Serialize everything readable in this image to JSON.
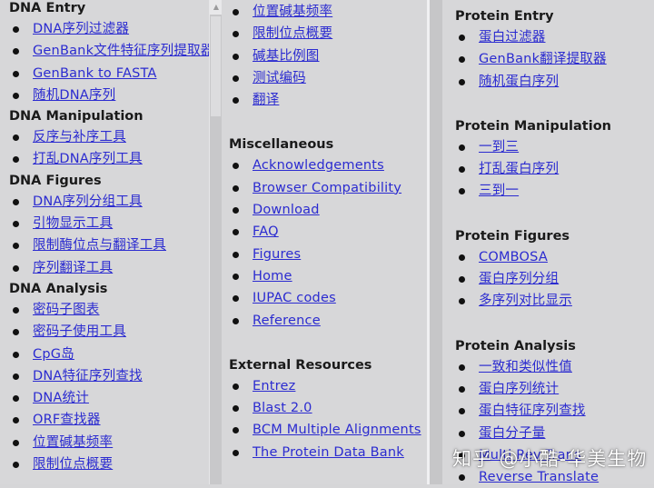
{
  "columns": [
    {
      "sections": [
        {
          "heading": "DNA Entry",
          "links": [
            "DNA序列过滤器",
            "GenBank文件特征序列提取器",
            "GenBank to FASTA",
            "随机DNA序列"
          ]
        },
        {
          "heading": "DNA Manipulation",
          "links": [
            "反序与补序工具",
            "打乱DNA序列工具"
          ]
        },
        {
          "heading": "DNA Figures",
          "links": [
            "DNA序列分组工具",
            "引物显示工具",
            "限制酶位点与翻译工具",
            "序列翻译工具"
          ]
        },
        {
          "heading": "DNA Analysis",
          "links": [
            "密码子图表",
            "密码子使用工具",
            "CpG岛",
            "DNA特征序列查找",
            "DNA统计",
            "ORF查找器",
            "位置碱基频率",
            "限制位点概要"
          ]
        }
      ]
    },
    {
      "sections": [
        {
          "heading": "",
          "links": [
            "位置碱基频率",
            "限制位点概要",
            "碱基比例图",
            "测试编码",
            "翻译"
          ]
        },
        {
          "heading": "Miscellaneous",
          "links": [
            "Acknowledgements",
            "Browser Compatibility",
            "Download",
            "FAQ",
            "Figures",
            "Home",
            "IUPAC codes",
            "Reference"
          ]
        },
        {
          "heading": "External Resources",
          "links": [
            "Entrez",
            "Blast 2.0",
            "BCM Multiple Alignments",
            "The Protein Data Bank"
          ]
        }
      ]
    },
    {
      "sections": [
        {
          "heading": "Protein Entry",
          "links": [
            "蛋白过滤器",
            "GenBank翻译提取器",
            "随机蛋白序列"
          ]
        },
        {
          "heading": "Protein Manipulation",
          "links": [
            "一到三",
            "打乱蛋白序列",
            "三到一"
          ]
        },
        {
          "heading": "Protein Figures",
          "links": [
            "COMBOSA",
            "蛋白序列分组",
            "多序列对比显示"
          ]
        },
        {
          "heading": "Protein Analysis",
          "links": [
            "一致和类似性值",
            "蛋白序列统计",
            "蛋白特征序列查找",
            "蛋白分子量",
            "Multi Rev Trans",
            "Reverse Translate"
          ]
        }
      ]
    }
  ],
  "scrollbar": {
    "up_arrow_icon": "▲"
  },
  "watermark": "知乎 @小酷-华美生物",
  "colors": {
    "link": "#2b2bd0",
    "background": "#d7d7d9",
    "heading": "#1a1a1a"
  }
}
